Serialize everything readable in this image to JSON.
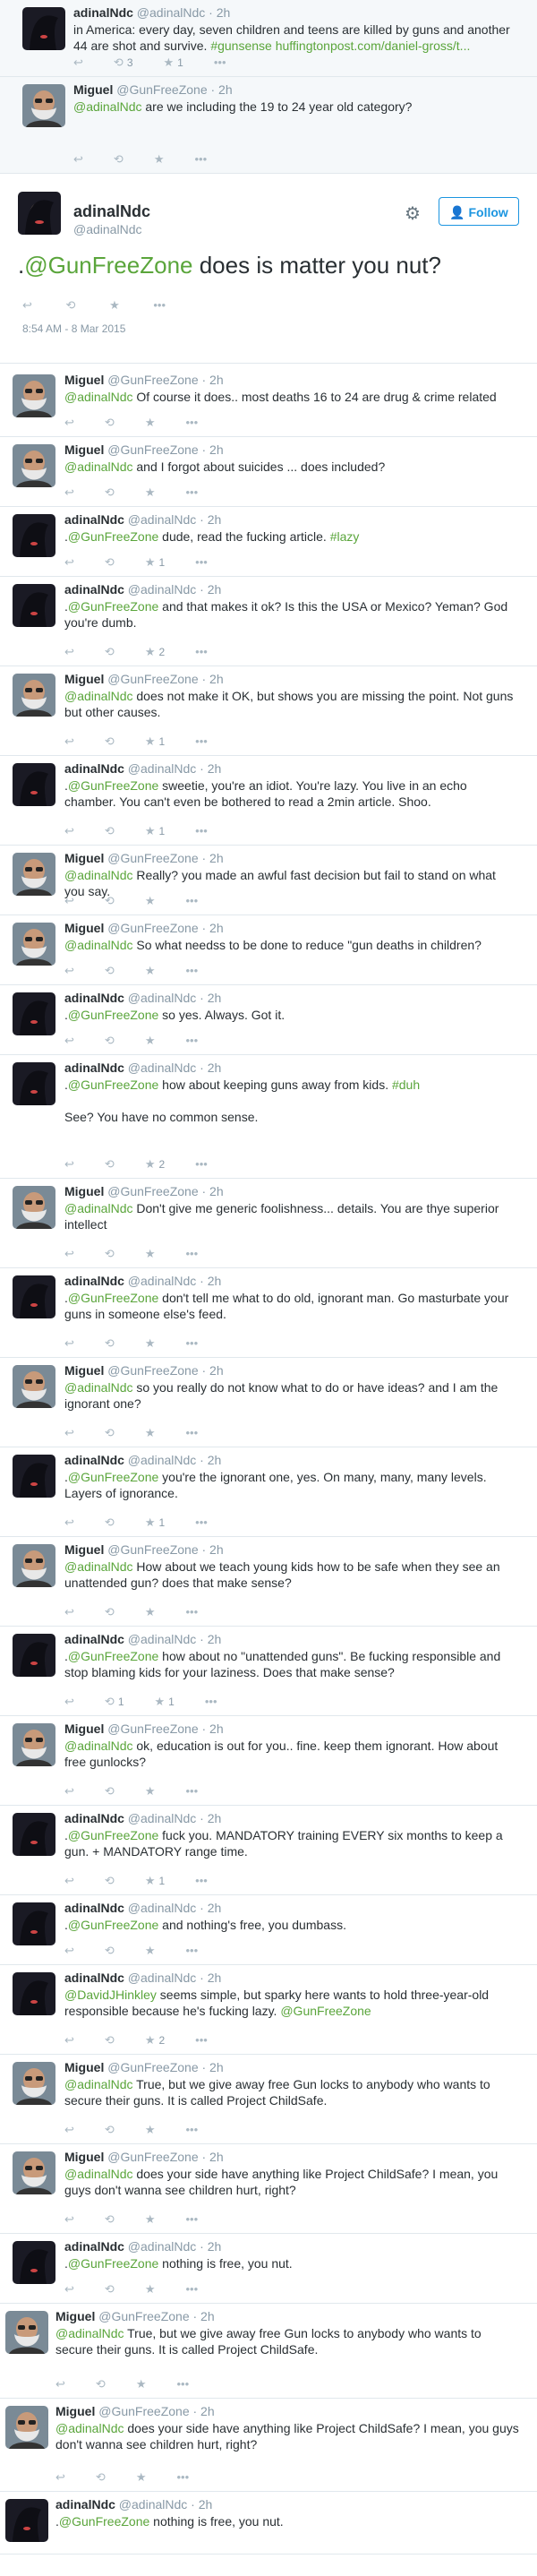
{
  "top": [
    {
      "name": "adinalNdc",
      "handle": "@adinalNdc",
      "time": "· 2h",
      "text_parts": [
        {
          "t": "in America: every day, seven children and teens are killed by guns and another 44 are shot and survive. "
        },
        {
          "t": "#gunsense huffingtonpost.com/daniel-gross/t...",
          "c": "lk2"
        }
      ],
      "retweets": "3",
      "favorites": "1"
    },
    {
      "name": "Miguel",
      "handle": "@GunFreeZone",
      "time": "· 2h",
      "text_parts": [
        {
          "t": "@adinalNdc",
          "c": "lk2"
        },
        {
          "t": " are we including the 19 to 24 year old category?"
        }
      ],
      "retweets": "",
      "favorites": ""
    }
  ],
  "main": {
    "name": "adinalNdc",
    "handle": "@adinalNdc",
    "follow_label": "Follow",
    "text_prefix": ".",
    "mention": "@GunFreeZone",
    "text_rest": " does is matter you nut?",
    "timestamp": "8:54 AM - 8 Mar 2015"
  },
  "replies": [
    {
      "name": "Miguel",
      "handle": "@GunFreeZone",
      "time": "· 2h",
      "text_parts": [
        {
          "t": "@adinalNdc",
          "c": "lk2"
        },
        {
          "t": " Of course it does.. most deaths 16 to 24 are drug & crime related"
        }
      ],
      "retweets": "",
      "favorites": ""
    },
    {
      "name": "Miguel",
      "handle": "@GunFreeZone",
      "time": "· 2h",
      "text_parts": [
        {
          "t": "@adinalNdc",
          "c": "lk2"
        },
        {
          "t": " and I forgot about suicides ... does included?"
        }
      ],
      "retweets": "",
      "favorites": ""
    },
    {
      "name": "adinalNdc",
      "handle": "@adinalNdc",
      "time": "· 2h",
      "text_parts": [
        {
          "t": "."
        },
        {
          "t": "@GunFreeZone",
          "c": "lk2"
        },
        {
          "t": " dude, read the fucking article. "
        },
        {
          "t": "#lazy",
          "c": "lk2"
        }
      ],
      "retweets": "",
      "favorites": "1"
    },
    {
      "name": "adinalNdc",
      "handle": "@adinalNdc",
      "time": "· 2h",
      "text_parts": [
        {
          "t": "."
        },
        {
          "t": "@GunFreeZone",
          "c": "lk2"
        },
        {
          "t": " and that makes it ok? Is this the USA or Mexico? Yeman? God you're dumb."
        }
      ],
      "retweets": "",
      "favorites": "2"
    },
    {
      "name": "Miguel",
      "handle": "@GunFreeZone",
      "time": "· 2h",
      "text_parts": [
        {
          "t": "@adinalNdc",
          "c": "lk2"
        },
        {
          "t": " does not make it OK, but shows you are missing the point. Not guns but other causes."
        }
      ],
      "retweets": "",
      "favorites": "1"
    },
    {
      "name": "adinalNdc",
      "handle": "@adinalNdc",
      "time": "· 2h",
      "text_parts": [
        {
          "t": "."
        },
        {
          "t": "@GunFreeZone",
          "c": "lk2"
        },
        {
          "t": " sweetie, you're an idiot. You're lazy. You live in an echo chamber. You can't even be bothered to read a 2min article. Shoo."
        }
      ],
      "retweets": "",
      "favorites": "1"
    },
    {
      "name": "Miguel",
      "handle": "@GunFreeZone",
      "time": "· 2h",
      "text_parts": [
        {
          "t": "@adinalNdc",
          "c": "lk2"
        },
        {
          "t": " Really? you made an awful fast decision but fail to stand on what you say."
        }
      ],
      "retweets": "",
      "favorites": ""
    },
    {
      "name": "Miguel",
      "handle": "@GunFreeZone",
      "time": "· 2h",
      "text_parts": [
        {
          "t": "@adinalNdc",
          "c": "lk2"
        },
        {
          "t": " So what needss to be done to reduce \"gun deaths in children?"
        }
      ],
      "retweets": "",
      "favorites": ""
    },
    {
      "name": "adinalNdc",
      "handle": "@adinalNdc",
      "time": "· 2h",
      "text_parts": [
        {
          "t": "."
        },
        {
          "t": "@GunFreeZone",
          "c": "lk2"
        },
        {
          "t": " so yes. Always. Got it."
        }
      ],
      "retweets": "",
      "favorites": ""
    },
    {
      "name": "adinalNdc",
      "handle": "@adinalNdc",
      "time": "· 2h",
      "text_parts": [
        {
          "t": "."
        },
        {
          "t": "@GunFreeZone",
          "c": "lk2"
        },
        {
          "t": " how about keeping guns away from kids. "
        },
        {
          "t": "#duh",
          "c": "lk2"
        },
        {
          "t": "\n\nSee? You have no common sense."
        }
      ],
      "retweets": "",
      "favorites": "2"
    },
    {
      "name": "Miguel",
      "handle": "@GunFreeZone",
      "time": "· 2h",
      "text_parts": [
        {
          "t": "@adinalNdc",
          "c": "lk2"
        },
        {
          "t": " Don't give me generic foolishness... details. You are thye superior intellect"
        }
      ],
      "retweets": "",
      "favorites": ""
    },
    {
      "name": "adinalNdc",
      "handle": "@adinalNdc",
      "time": "· 2h",
      "text_parts": [
        {
          "t": "."
        },
        {
          "t": "@GunFreeZone",
          "c": "lk2"
        },
        {
          "t": " don't tell me what to do old, ignorant man. Go masturbate your guns in someone else's feed."
        }
      ],
      "retweets": "",
      "favorites": ""
    },
    {
      "name": "Miguel",
      "handle": "@GunFreeZone",
      "time": "· 2h",
      "text_parts": [
        {
          "t": "@adinalNdc",
          "c": "lk2"
        },
        {
          "t": " so you really do not know what to do or have ideas? and I am the ignorant one?"
        }
      ],
      "retweets": "",
      "favorites": ""
    },
    {
      "name": "adinalNdc",
      "handle": "@adinalNdc",
      "time": "· 2h",
      "text_parts": [
        {
          "t": "."
        },
        {
          "t": "@GunFreeZone",
          "c": "lk2"
        },
        {
          "t": " you're the ignorant one, yes. On many, many, many levels. Layers of ignorance."
        }
      ],
      "retweets": "",
      "favorites": "1"
    },
    {
      "name": "Miguel",
      "handle": "@GunFreeZone",
      "time": "· 2h",
      "text_parts": [
        {
          "t": "@adinalNdc",
          "c": "lk2"
        },
        {
          "t": " How about we teach young kids how to be safe when they see an unattended gun? does that make sense?"
        }
      ],
      "retweets": "",
      "favorites": ""
    },
    {
      "name": "adinalNdc",
      "handle": "@adinalNdc",
      "time": "· 2h",
      "text_parts": [
        {
          "t": "."
        },
        {
          "t": "@GunFreeZone",
          "c": "lk2"
        },
        {
          "t": " how about no \"unattended guns\". Be fucking responsible and stop blaming kids for your laziness. Does that make sense?"
        }
      ],
      "retweets": "1",
      "favorites": "1"
    },
    {
      "name": "Miguel",
      "handle": "@GunFreeZone",
      "time": "· 2h",
      "text_parts": [
        {
          "t": "@adinalNdc",
          "c": "lk2"
        },
        {
          "t": " ok, education is out for you.. fine. keep them ignorant. How about free gunlocks?"
        }
      ],
      "retweets": "",
      "favorites": ""
    },
    {
      "name": "adinalNdc",
      "handle": "@adinalNdc",
      "time": "· 2h",
      "text_parts": [
        {
          "t": "."
        },
        {
          "t": "@GunFreeZone",
          "c": "lk2"
        },
        {
          "t": " fuck you. MANDATORY training EVERY six months to keep a gun. + MANDATORY range time."
        }
      ],
      "retweets": "",
      "favorites": "1"
    },
    {
      "name": "adinalNdc",
      "handle": "@adinalNdc",
      "time": "· 2h",
      "text_parts": [
        {
          "t": "."
        },
        {
          "t": "@GunFreeZone",
          "c": "lk2"
        },
        {
          "t": " and nothing's free, you dumbass."
        }
      ],
      "retweets": "",
      "favorites": ""
    },
    {
      "name": "adinalNdc",
      "handle": "@adinalNdc",
      "time": "· 2h",
      "text_parts": [
        {
          "t": "@DavidJHinkley",
          "c": "lk2"
        },
        {
          "t": " seems simple, but sparky here wants to hold three-year-old responsible  because he's fucking lazy. "
        },
        {
          "t": "@GunFreeZone",
          "c": "lk2"
        }
      ],
      "retweets": "",
      "favorites": "2"
    },
    {
      "name": "Miguel",
      "handle": "@GunFreeZone",
      "time": "· 2h",
      "text_parts": [
        {
          "t": "@adinalNdc",
          "c": "lk2"
        },
        {
          "t": " True, but we give away free Gun locks to anybody who wants to secure their guns. It is called Project ChildSafe."
        }
      ],
      "retweets": "",
      "favorites": ""
    },
    {
      "name": "Miguel",
      "handle": "@GunFreeZone",
      "time": "· 2h",
      "text_parts": [
        {
          "t": "@adinalNdc",
          "c": "lk2"
        },
        {
          "t": " does your side have anything like Project ChildSafe? I mean, you guys don't wanna see children hurt, right?"
        }
      ],
      "retweets": "",
      "favorites": ""
    },
    {
      "name": "adinalNdc",
      "handle": "@adinalNdc",
      "time": "· 2h",
      "text_parts": [
        {
          "t": "."
        },
        {
          "t": "@GunFreeZone",
          "c": "lk2"
        },
        {
          "t": " nothing is free, you nut."
        }
      ],
      "retweets": "",
      "favorites": ""
    }
  ],
  "bottom": [
    {
      "name": "Miguel",
      "handle": "@GunFreeZone",
      "time": "· 2h",
      "text_parts": [
        {
          "t": "@adinalNdc",
          "c": "lk2"
        },
        {
          "t": " True, but we give away free Gun locks to anybody who wants to secure their guns. It is called Project ChildSafe."
        }
      ]
    },
    {
      "name": "Miguel",
      "handle": "@GunFreeZone",
      "time": "· 2h",
      "text_parts": [
        {
          "t": "@adinalNdc",
          "c": "lk2"
        },
        {
          "t": " does your side have anything like Project ChildSafe? I mean, you guys don't wanna see children hurt, right?"
        }
      ]
    },
    {
      "name": "adinalNdc",
      "handle": "@adinalNdc",
      "time": "· 2h",
      "text_parts": [
        {
          "t": "."
        },
        {
          "t": "@GunFreeZone",
          "c": "lk2"
        },
        {
          "t": " nothing is free, you nut."
        }
      ]
    }
  ],
  "colors": {
    "link": "#5aa53b",
    "muted": "#8899a6",
    "border": "#e1e8ed"
  }
}
